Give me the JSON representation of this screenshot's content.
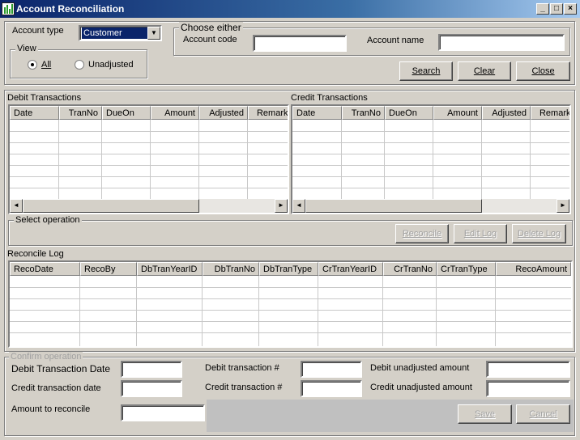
{
  "window": {
    "title": "Account Reconciliation",
    "buttons": {
      "minimize": "_",
      "maximize": "□",
      "close": "×"
    }
  },
  "account_type": {
    "label": "Account type",
    "value": "Customer"
  },
  "view": {
    "label": "View",
    "all": "All",
    "unadjusted": "Unadjusted",
    "selected": "All"
  },
  "choose": {
    "label": "Choose either",
    "account_code_label": "Account code",
    "account_code_value": "",
    "account_name_label": "Account name",
    "account_name_value": ""
  },
  "actions": {
    "search": "Search",
    "clear": "Clear",
    "close": "Close"
  },
  "debit": {
    "title": "Debit Transactions",
    "columns": [
      "Date",
      "TranNo",
      "DueOn",
      "Amount",
      "Adjusted",
      "Remarks"
    ]
  },
  "credit": {
    "title": "Credit Transactions",
    "columns": [
      "Date",
      "TranNo",
      "DueOn",
      "Amount",
      "Adjusted",
      "Remarks"
    ]
  },
  "operation": {
    "label": "Select operation",
    "reconcile": "Reconcile",
    "edit_log": "Edit Log",
    "delete_log": "Delete Log"
  },
  "log": {
    "title": "Reconcile Log",
    "columns": [
      "RecoDate",
      "RecoBy",
      "DbTranYearID",
      "DbTranNo",
      "DbTranType",
      "CrTranYearID",
      "CrTranNo",
      "CrTranType",
      "RecoAmount"
    ]
  },
  "confirm": {
    "label": "Confirm operation",
    "debit_date_label": "Debit Transaction Date",
    "credit_date_label": "Credit transaction date",
    "amount_label": "Amount to reconcile",
    "debit_no_label": "Debit transaction #",
    "credit_no_label": "Credit transaction #",
    "debit_unadj_label": "Debit unadjusted amount",
    "credit_unadj_label": "Credit unadjusted amount",
    "save": "Save",
    "cancel": "Cancel"
  },
  "icons": {
    "scroll_left": "◄",
    "scroll_right": "►",
    "dropdown": "▼"
  }
}
